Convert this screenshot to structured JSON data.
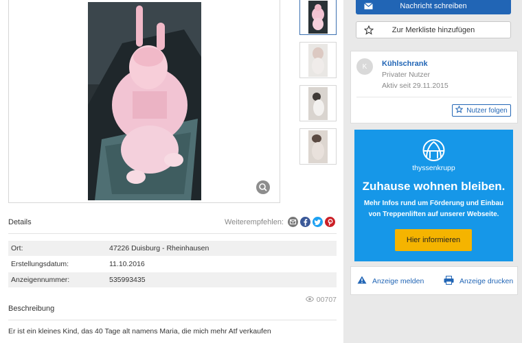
{
  "contact": {
    "message_button": "Nachricht schreiben",
    "watchlist_button": "Zur Merkliste hinzufügen"
  },
  "seller": {
    "avatar_letter": "K",
    "name": "Kühlschrank",
    "type": "Privater Nutzer",
    "active_since": "Aktiv seit 29.11.2015",
    "follow_button": "Nutzer folgen"
  },
  "ad_banner": {
    "brand": "thyssenkrupp",
    "headline": "Zuhause wohnen bleiben.",
    "body": "Mehr Infos rund um Förderung und Einbau von Treppenliften auf unserer Webseite.",
    "cta": "Hier informieren",
    "background_color": "#1697e8",
    "cta_color": "#f5b400"
  },
  "actions": {
    "report": "Anzeige melden",
    "print": "Anzeige drucken"
  },
  "details": {
    "title": "Details",
    "share_label": "Weiterempfehlen:",
    "share_icons": [
      "email-icon",
      "facebook-icon",
      "twitter-icon",
      "pinterest-icon"
    ],
    "rows": [
      {
        "key": "Ort:",
        "value": "47226 Duisburg - Rheinhausen"
      },
      {
        "key": "Erstellungsdatum:",
        "value": "11.10.2016"
      },
      {
        "key": "Anzeigennummer:",
        "value": "535993435"
      }
    ]
  },
  "description": {
    "title": "Beschreibung",
    "views": "00707",
    "text": "Er ist ein kleines Kind, das 40 Tage alt namens Maria, die mich mehr Atf verkaufen"
  },
  "colors": {
    "primary": "#2165b5",
    "share_email": "#7a7a7a",
    "share_facebook": "#3b5998",
    "share_twitter": "#1da1f2",
    "share_pinterest": "#cb2027"
  }
}
